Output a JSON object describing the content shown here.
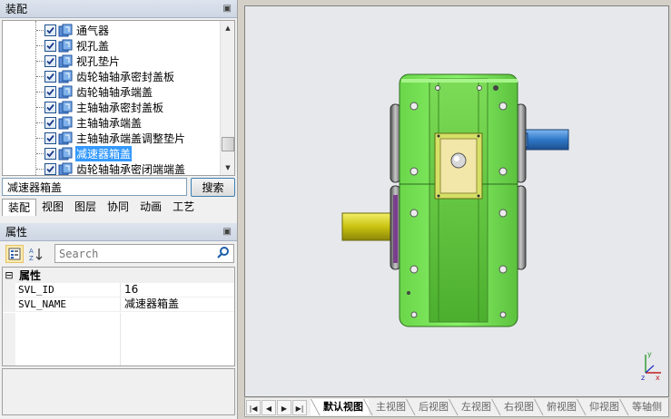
{
  "assembly_panel": {
    "title": "装配",
    "pin_icon": "pin-icon",
    "tree_items": [
      {
        "label": "通气器",
        "checked": true,
        "selected": false
      },
      {
        "label": "视孔盖",
        "checked": true,
        "selected": false
      },
      {
        "label": "视孔垫片",
        "checked": true,
        "selected": false
      },
      {
        "label": "齿轮轴轴承密封盖板",
        "checked": true,
        "selected": false
      },
      {
        "label": "齿轮轴轴承端盖",
        "checked": true,
        "selected": false
      },
      {
        "label": "主轴轴承密封盖板",
        "checked": true,
        "selected": false
      },
      {
        "label": "主轴轴承端盖",
        "checked": true,
        "selected": false
      },
      {
        "label": "主轴轴承端盖调整垫片",
        "checked": true,
        "selected": false
      },
      {
        "label": "减速器箱盖",
        "checked": true,
        "selected": true
      },
      {
        "label": "齿轮轴轴承密闭端端盖",
        "checked": true,
        "selected": false
      }
    ],
    "search_value": "减速器箱盖",
    "search_button": "搜索",
    "tabs": [
      "装配",
      "视图",
      "图层",
      "协同",
      "动画",
      "工艺"
    ],
    "active_tab": 0
  },
  "properties_panel": {
    "title": "属性",
    "search_placeholder": "Search",
    "category": "属性",
    "rows": [
      {
        "key": "SVL_ID",
        "value": "16"
      },
      {
        "key": "SVL_NAME",
        "value": "减速器箱盖"
      }
    ]
  },
  "view_tabs": {
    "tabs": [
      "默认视图",
      "主视图",
      "后视图",
      "左视图",
      "右视图",
      "俯视图",
      "仰视图",
      "等轴侧"
    ],
    "active": 0
  },
  "colors": {
    "housing_green": "#7fea5a",
    "shaft_blue": "#3f86d0",
    "shaft_yellow": "#d9d21a",
    "selection_blue": "#3399ff"
  }
}
